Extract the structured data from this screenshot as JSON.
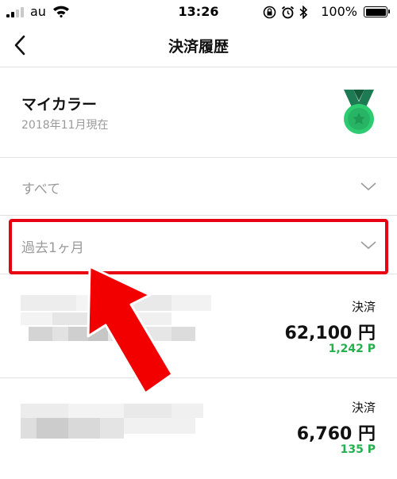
{
  "status_bar": {
    "carrier": "au",
    "time": "13:26",
    "battery": "100%",
    "battery_level": 1.0
  },
  "nav": {
    "title": "決済履歴"
  },
  "rank": {
    "name": "マイカラー",
    "as_of": "2018年11月現在",
    "medal_color": "#2ecc71"
  },
  "filters": [
    {
      "label": "すべて"
    },
    {
      "label": "過去1ヶ月"
    }
  ],
  "transactions": [
    {
      "type": "決済",
      "amount": "62,100 円",
      "points": "1,242 P"
    },
    {
      "type": "決済",
      "amount": "6,760 円",
      "points": "135 P"
    }
  ],
  "colors": {
    "highlight": "#e60012",
    "points": "#22b14c"
  }
}
